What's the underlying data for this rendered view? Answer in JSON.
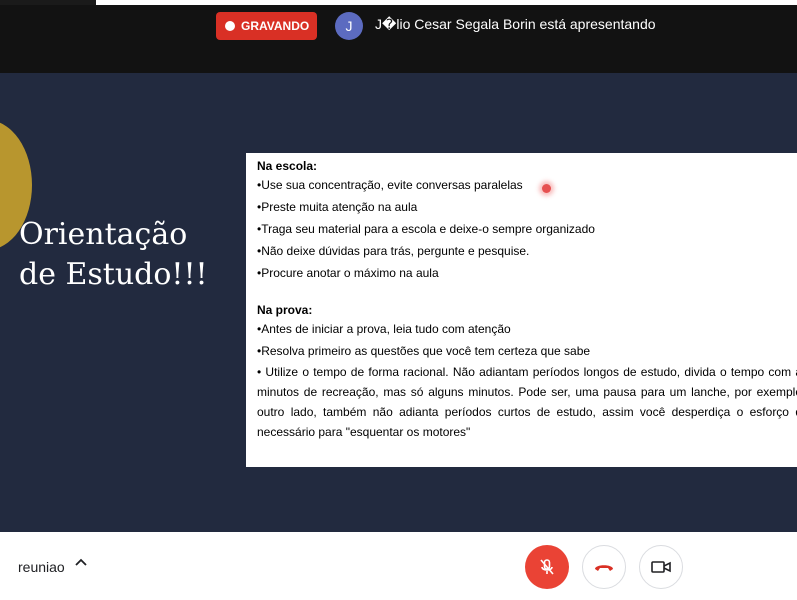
{
  "recording": {
    "label": "GRAVANDO"
  },
  "presenter": {
    "initial": "J",
    "text": "J�lio Cesar Segala Borin está apresentando"
  },
  "slide": {
    "title": "Orientação\nde Estudo!!!"
  },
  "document": {
    "school": {
      "heading": "Na escola:",
      "items": [
        "Use sua concentração, evite conversas paralelas",
        "Preste muita atenção na aula",
        "Traga seu material para a escola e deixe-o sempre organizado",
        "Não deixe dúvidas para trás, pergunte e pesquise.",
        "Procure anotar o máximo na aula"
      ]
    },
    "exam": {
      "heading": "Na prova:",
      "items": [
        "Antes de iniciar a prova, leia tudo com atenção",
        "Resolva primeiro as questões que você tem certeza que sabe"
      ],
      "paragraph": "• Utilize o tempo de forma racional. Não adiantam períodos longos de estudo, divida o tempo com a minutos de recreação, mas só alguns minutos. Pode ser, uma pausa para um lanche, por exemplo outro lado, também não adianta períodos curtos de estudo, assim você desperdiça o esforço q necessário para \"esquentar os motores\""
    }
  },
  "footer": {
    "meeting_name": "reuniao"
  },
  "icons": {
    "mic": "mic-off-icon",
    "hangup": "phone-hangup-icon",
    "camera": "video-camera-icon",
    "chevron": "chevron-up-icon"
  },
  "colors": {
    "record": "#d93025",
    "mic_off": "#ea4335",
    "hangup": "#d93025",
    "stage": "#222a3f",
    "avatar": "#5c6bc0"
  }
}
